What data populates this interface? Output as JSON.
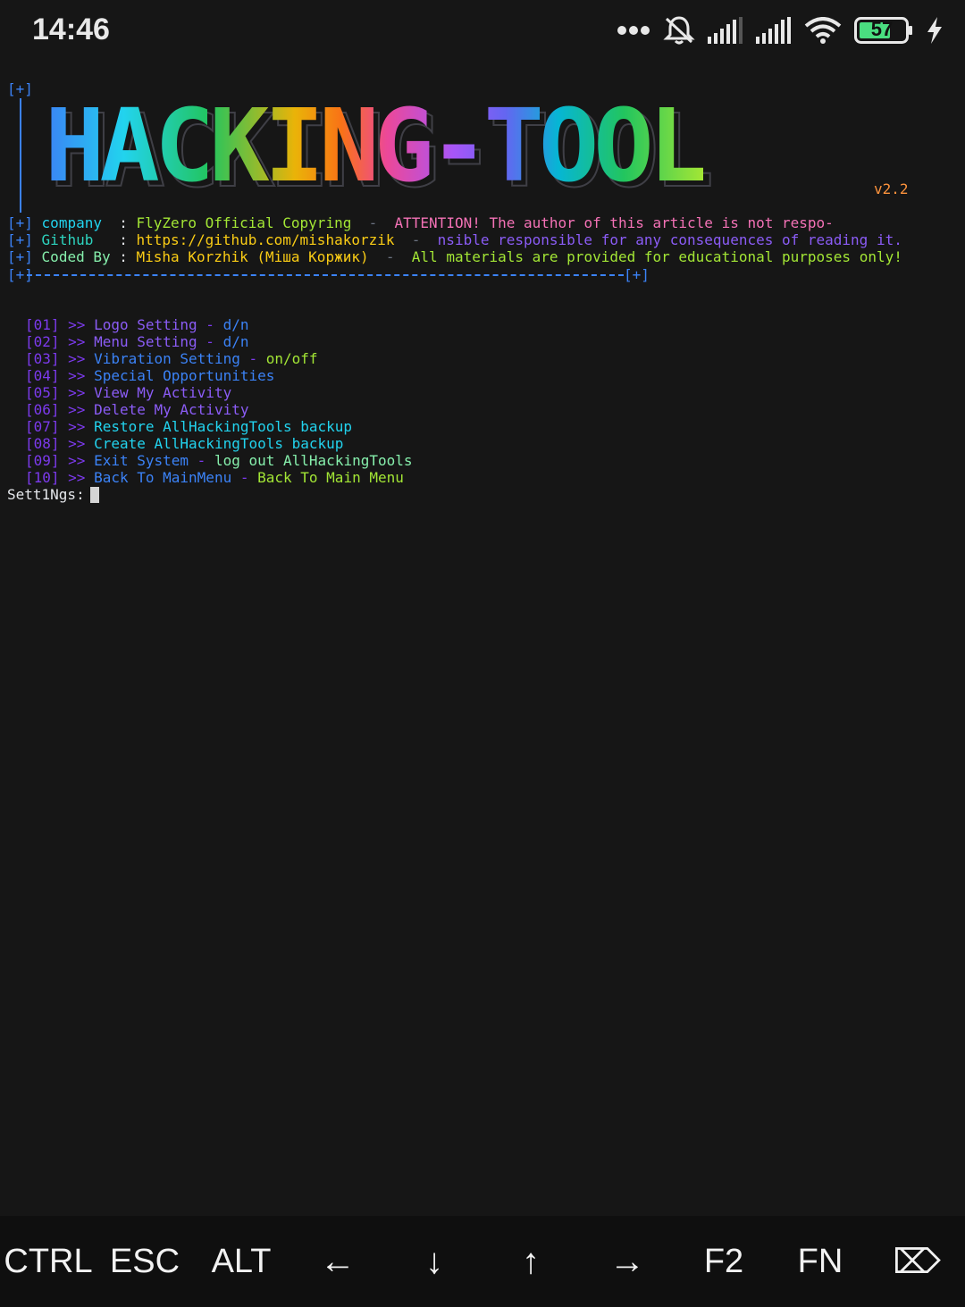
{
  "status_bar": {
    "time": "14:46",
    "battery": "57",
    "icons": [
      "more-dots-icon",
      "notifications-muted-icon",
      "signal-icon",
      "signal-icon",
      "wifi-icon",
      "battery-icon",
      "charging-icon"
    ]
  },
  "banner": {
    "logo_text": "HACKING-TOOL",
    "version": "v2.2",
    "top_marker": "[+]",
    "info_lines": [
      {
        "marker": "[+]",
        "key": "company  ",
        "value": "FlyZero Official Copyring",
        "sep": "  -  ",
        "notice": "ATTENTION! The author of this article is not respo-"
      },
      {
        "marker": "[+]",
        "key": "Github   ",
        "value": "https://github.com/mishakorzik",
        "sep": "  -  ",
        "notice": "nsible responsible for any consequences of reading it."
      },
      {
        "marker": "[+]",
        "key": "Coded By ",
        "value": "Misha Korzhik (Міша Коржик)",
        "sep": "  -  ",
        "notice": "All materials are provided for educational purposes only!"
      }
    ],
    "divider_start": "[+]",
    "divider_end": "[+]"
  },
  "menu": {
    "items": [
      {
        "num": "[01]",
        "arrow": ">>",
        "label": "Logo Setting",
        "dash": " - ",
        "hint": "d/n"
      },
      {
        "num": "[02]",
        "arrow": ">>",
        "label": "Menu Setting",
        "dash": " - ",
        "hint": "d/n"
      },
      {
        "num": "[03]",
        "arrow": ">>",
        "label": "Vibration Setting",
        "dash": " - ",
        "hint": "on/off"
      },
      {
        "num": "[04]",
        "arrow": ">>",
        "label": "Special Opportunities",
        "dash": "",
        "hint": ""
      },
      {
        "num": "[05]",
        "arrow": ">>",
        "label": "View My Activity",
        "dash": "",
        "hint": ""
      },
      {
        "num": "[06]",
        "arrow": ">>",
        "label": "Delete My Activity",
        "dash": "",
        "hint": ""
      },
      {
        "num": "[07]",
        "arrow": ">>",
        "label": "Restore AllHackingTools backup",
        "dash": "",
        "hint": ""
      },
      {
        "num": "[08]",
        "arrow": ">>",
        "label": "Create AllHackingTools backup",
        "dash": "",
        "hint": ""
      },
      {
        "num": "[09]",
        "arrow": ">>",
        "label": "Exit System",
        "dash": " - ",
        "hint": "log out AllHackingTools"
      },
      {
        "num": "[10]",
        "arrow": ">>",
        "label": "Back To MainMenu",
        "dash": " - ",
        "hint": "Back To Main Menu"
      }
    ],
    "prompt": "Sett1Ngs:"
  },
  "extra_keys": [
    "CTRL",
    "ESC",
    "ALT",
    "←",
    "↓",
    "↑",
    "→",
    "F2",
    "FN",
    "⌦"
  ]
}
